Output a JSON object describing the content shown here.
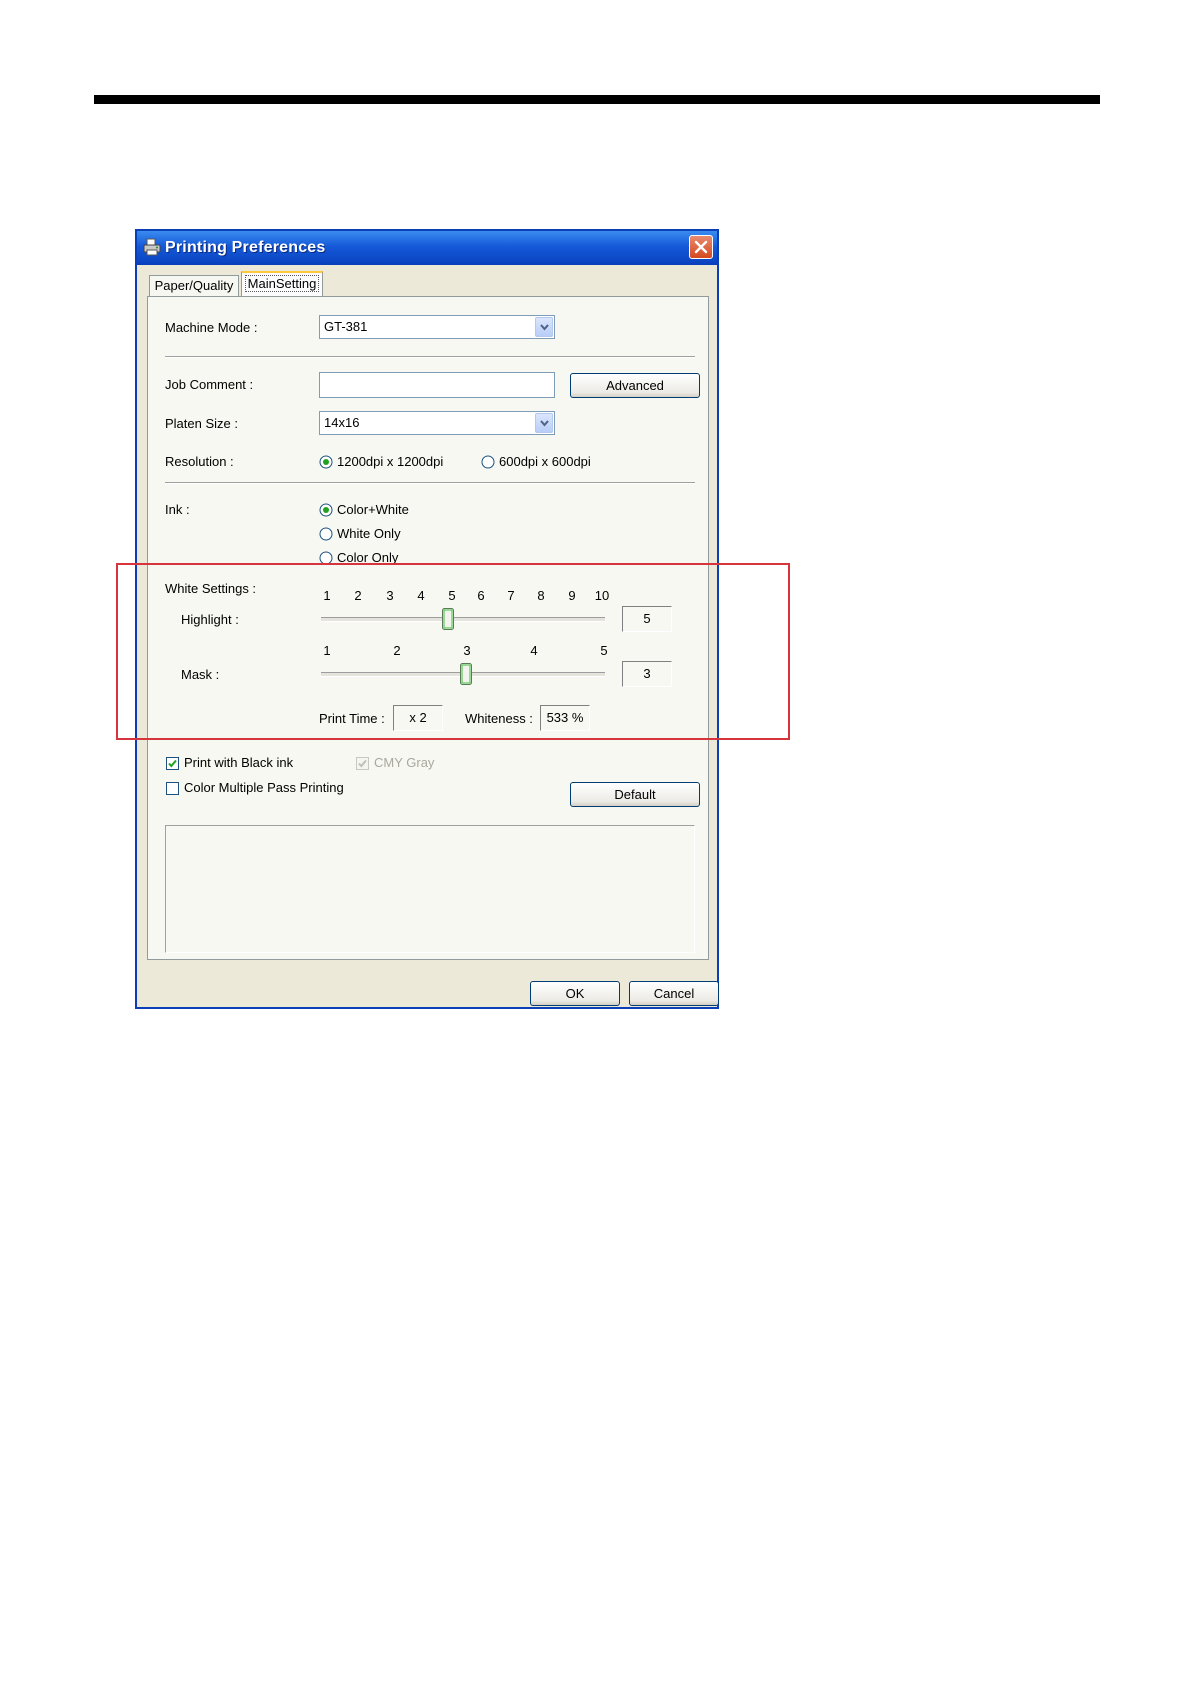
{
  "window": {
    "title": "Printing Preferences"
  },
  "tabs": [
    {
      "label": "Paper/Quality",
      "selected": false
    },
    {
      "label": "MainSetting",
      "selected": true
    }
  ],
  "machine_mode": {
    "label": "Machine Mode :",
    "value": "GT-381"
  },
  "job_comment": {
    "label": "Job Comment :",
    "value": "",
    "advanced_button": "Advanced"
  },
  "platen_size": {
    "label": "Platen Size :",
    "value": "14x16"
  },
  "resolution": {
    "label": "Resolution :",
    "options": [
      "1200dpi x 1200dpi",
      "600dpi x 600dpi"
    ],
    "selected": "1200dpi x 1200dpi"
  },
  "ink": {
    "label": "Ink :",
    "options": [
      "Color+White",
      "White Only",
      "Color Only"
    ],
    "selected": "Color+White"
  },
  "white_settings": {
    "label": "White Settings :",
    "highlight": {
      "label": "Highlight :",
      "ticks": [
        "1",
        "2",
        "3",
        "4",
        "5",
        "6",
        "7",
        "8",
        "9",
        "10"
      ],
      "value": "5"
    },
    "mask": {
      "label": "Mask :",
      "ticks": [
        "1",
        "2",
        "3",
        "4",
        "5"
      ],
      "value": "3"
    },
    "print_time": {
      "label": "Print Time :",
      "value": "x 2"
    },
    "whiteness": {
      "label": "Whiteness :",
      "value": "533 %"
    }
  },
  "options": {
    "print_black": {
      "label": "Print with Black ink",
      "checked": true
    },
    "cmy_gray": {
      "label": "CMY Gray",
      "checked": true,
      "enabled": false
    },
    "multi_pass": {
      "label": "Color Multiple Pass Printing",
      "checked": false
    },
    "default_button": "Default"
  },
  "footer": {
    "ok": "OK",
    "cancel": "Cancel"
  },
  "colors": {
    "titlebar": "#0a3fb8",
    "dialog_bg": "#ece9d8",
    "highlight_frame": "#d8343e"
  }
}
